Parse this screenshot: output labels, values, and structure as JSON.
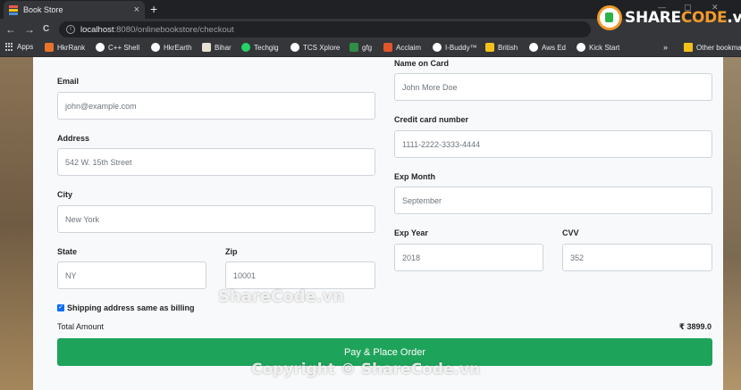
{
  "browser": {
    "tab_title": "Book Store",
    "tab_close": "×",
    "new_tab": "+",
    "nav": {
      "back": "←",
      "forward": "→",
      "reload": "C"
    },
    "url_host": "localhost",
    "url_path": ":8080/onlinebookstore/checkout",
    "window_controls": {
      "minimize": "—",
      "maximize": "▢",
      "close": "✕"
    },
    "logo": {
      "part1": "SHARE",
      "part2": "CODE",
      "suffix": ".vn"
    },
    "bookmarks": [
      {
        "label": "Apps",
        "icon": "apps-icon",
        "color": "#c8c9cc"
      },
      {
        "label": "HkrRank",
        "icon": "hackerrank-icon",
        "color": "#e8742b"
      },
      {
        "label": "C++ Shell",
        "icon": "globe-icon",
        "color": "#ffffff"
      },
      {
        "label": "HkrEarth",
        "icon": "globe-icon",
        "color": "#ffffff"
      },
      {
        "label": "Bihar",
        "icon": "bihar-icon",
        "color": "#e8e2d4"
      },
      {
        "label": "Techgig",
        "icon": "whatsapp-icon",
        "color": "#25d366"
      },
      {
        "label": "TCS Xplore",
        "icon": "globe-icon",
        "color": "#ffffff"
      },
      {
        "label": "gfg",
        "icon": "gfg-icon",
        "color": "#2f8d46"
      },
      {
        "label": "Acclaim",
        "icon": "acclaim-icon",
        "color": "#e2542a"
      },
      {
        "label": "I-Buddy™",
        "icon": "globe-icon",
        "color": "#ffffff"
      },
      {
        "label": "British",
        "icon": "british-icon",
        "color": "#f2c21b"
      },
      {
        "label": "Aws Ed",
        "icon": "globe-icon",
        "color": "#ffffff"
      },
      {
        "label": "Kick Start",
        "icon": "globe-icon",
        "color": "#ffffff"
      }
    ],
    "bookmarks_overflow": "»",
    "other_bookmarks": "Other bookma"
  },
  "form": {
    "email": {
      "label": "Email",
      "value": "john@example.com"
    },
    "address": {
      "label": "Address",
      "value": "542 W. 15th Street"
    },
    "city": {
      "label": "City",
      "value": "New York"
    },
    "state": {
      "label": "State",
      "value": "NY"
    },
    "zip": {
      "label": "Zip",
      "value": "10001"
    },
    "name_on_card": {
      "label": "Name on Card",
      "value": "John More Doe"
    },
    "card_number": {
      "label": "Credit card number",
      "value": "1111-2222-3333-4444"
    },
    "exp_month": {
      "label": "Exp Month",
      "value": "September"
    },
    "exp_year": {
      "label": "Exp Year",
      "value": "2018"
    },
    "cvv": {
      "label": "CVV",
      "value": "352"
    },
    "shipping_same": {
      "label": "Shipping address same as billing",
      "checked": true,
      "mark": "✓"
    },
    "total_label": "Total Amount",
    "total_value": "₹ 3899.0",
    "pay_label": "Pay & Place Order"
  },
  "watermarks": {
    "top": "ShareCode.vn",
    "bottom": "Copyright © ShareCode.vn"
  },
  "colors": {
    "pay_button": "#1ea35a",
    "logo_orange": "#f09a2b",
    "checkbox": "#0d6efd"
  }
}
